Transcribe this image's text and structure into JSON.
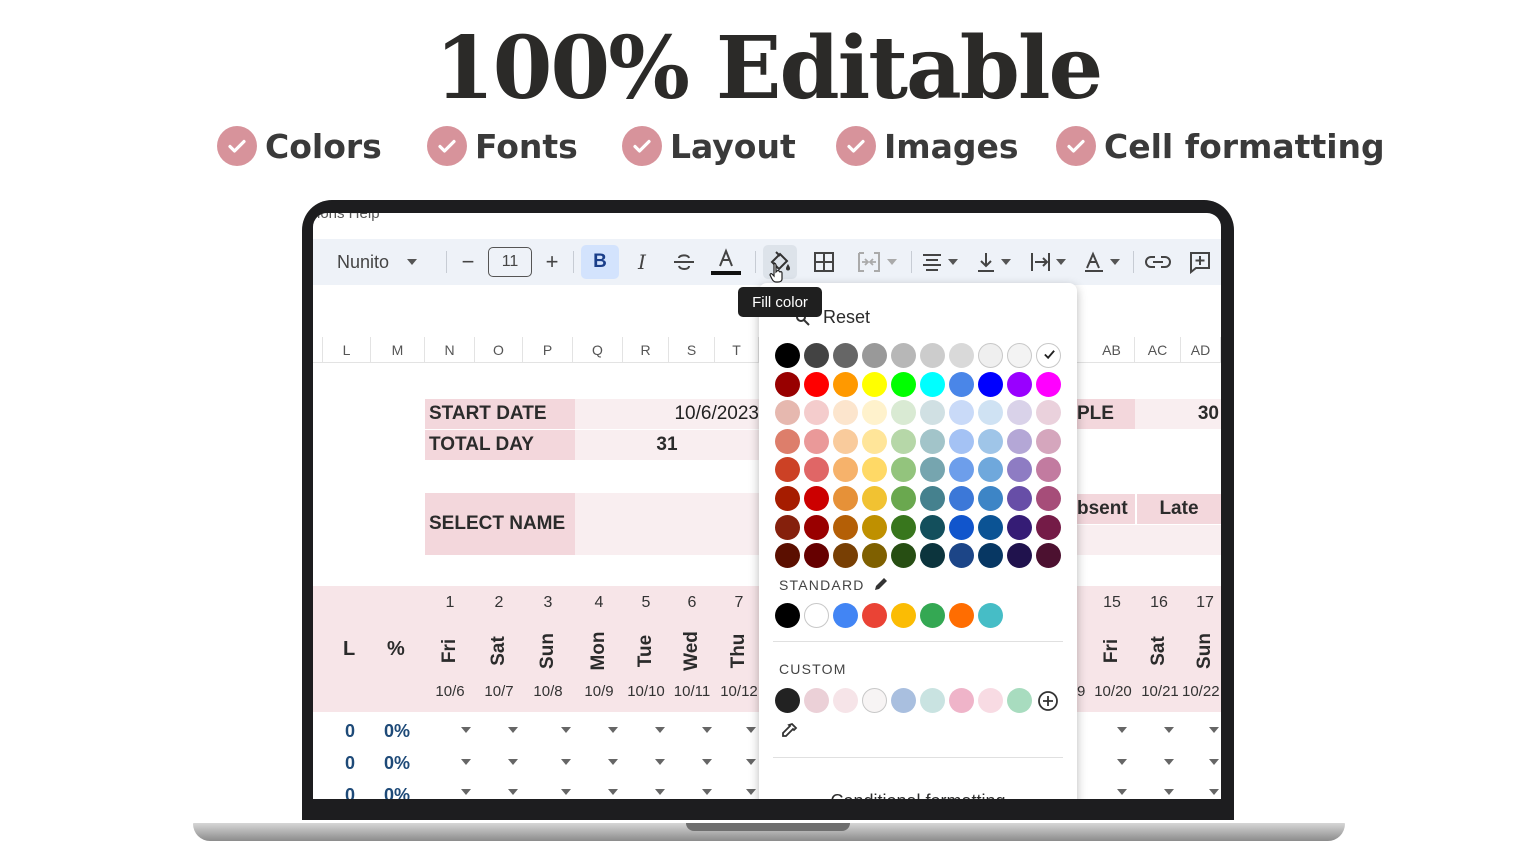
{
  "hero": {
    "title": "100% Editable",
    "features": [
      "Colors",
      "Fonts",
      "Layout",
      "Images",
      "Cell formatting"
    ]
  },
  "menu_peek": "ions   Help",
  "toolbar": {
    "font": "Nunito",
    "font_size": "11",
    "minus": "−",
    "plus": "+",
    "bold": "B",
    "italic": "I",
    "tooltip": "Fill color",
    "icons": [
      "font-dropdown-icon",
      "minus-icon",
      "plus-icon",
      "bold-icon",
      "italic-icon",
      "strikethrough-icon",
      "text-color-icon",
      "fill-color-icon",
      "borders-icon",
      "merge-cells-icon",
      "align-icon",
      "valign-icon",
      "text-wrap-icon",
      "text-rotation-icon",
      "link-icon",
      "comment-icon"
    ]
  },
  "columns": {
    "left": [
      "L",
      "M",
      "N",
      "O",
      "P",
      "Q",
      "R",
      "S",
      "T"
    ],
    "right": [
      "AB",
      "AC",
      "AD"
    ]
  },
  "sheet": {
    "start_date_label": "START DATE",
    "start_date_value": "10/6/2023",
    "total_day_label": "TOTAL DAY",
    "total_day_value": "31",
    "select_name_label": "SELECT NAME",
    "people_label": "PLE",
    "people_value": "30",
    "absent_label": "bsent",
    "late_label": "Late",
    "col_l": "L",
    "col_pct": "%",
    "days_left": [
      {
        "num": "1",
        "day": "Fri",
        "date": "10/6"
      },
      {
        "num": "2",
        "day": "Sat",
        "date": "10/7"
      },
      {
        "num": "3",
        "day": "Sun",
        "date": "10/8"
      },
      {
        "num": "4",
        "day": "Mon",
        "date": "10/9"
      },
      {
        "num": "5",
        "day": "Tue",
        "date": "10/10"
      },
      {
        "num": "6",
        "day": "Wed",
        "date": "10/11"
      },
      {
        "num": "7",
        "day": "Thu",
        "date": "10/12"
      }
    ],
    "days_right": [
      {
        "num": "15",
        "day": "Fri",
        "date": "10/20"
      },
      {
        "num": "16",
        "day": "Sat",
        "date": "10/21"
      },
      {
        "num": "17",
        "day": "Sun",
        "date": "10/22"
      }
    ],
    "date_peek": "9",
    "rows": [
      {
        "l": "0",
        "pct": "0%"
      },
      {
        "l": "0",
        "pct": "0%"
      },
      {
        "l": "0",
        "pct": "0%"
      }
    ]
  },
  "fill_menu": {
    "reset": "Reset",
    "standard_label": "STANDARD",
    "custom_label": "CUSTOM",
    "conditional": "Conditional formatting",
    "palette": [
      [
        "#000000",
        "#434343",
        "#666666",
        "#999999",
        "#b7b7b7",
        "#cccccc",
        "#d9d9d9",
        "#efefef",
        "#f3f3f3",
        "#ffffff"
      ],
      [
        "#980000",
        "#ff0000",
        "#ff9900",
        "#ffff00",
        "#00ff00",
        "#00ffff",
        "#4a86e8",
        "#0000ff",
        "#9900ff",
        "#ff00ff"
      ],
      [
        "#e6b8af",
        "#f4cccc",
        "#fce5cd",
        "#fff2cc",
        "#d9ead3",
        "#d0e0e3",
        "#c9daf8",
        "#cfe2f3",
        "#d9d2e9",
        "#ead1dc"
      ],
      [
        "#dd7e6b",
        "#ea9999",
        "#f9cb9c",
        "#ffe599",
        "#b6d7a8",
        "#a2c4c9",
        "#a4c2f4",
        "#9fc5e8",
        "#b4a7d6",
        "#d5a6bd"
      ],
      [
        "#cc4125",
        "#e06666",
        "#f6b26b",
        "#ffd966",
        "#93c47d",
        "#76a5af",
        "#6d9eeb",
        "#6fa8dc",
        "#8e7cc3",
        "#c27ba0"
      ],
      [
        "#a61c00",
        "#cc0000",
        "#e69138",
        "#f1c232",
        "#6aa84f",
        "#45818e",
        "#3c78d8",
        "#3d85c6",
        "#674ea7",
        "#a64d79"
      ],
      [
        "#85200c",
        "#990000",
        "#b45f06",
        "#bf9000",
        "#38761d",
        "#134f5c",
        "#1155cc",
        "#0b5394",
        "#351c75",
        "#741b47"
      ],
      [
        "#5b0f00",
        "#660000",
        "#783f04",
        "#7f6000",
        "#274e13",
        "#0c343d",
        "#1c4587",
        "#073763",
        "#20124d",
        "#4c1130"
      ]
    ],
    "standard": [
      "#000000",
      "#ffffff",
      "#4285f4",
      "#ea4335",
      "#fbbc04",
      "#34a853",
      "#ff6d01",
      "#46bdc6"
    ],
    "custom": [
      "#222222",
      "#ebd0d7",
      "#f6e4e8",
      "#f7f4f4",
      "#a9bfdf",
      "#c9e3e1",
      "#efb4c9",
      "#f8dbe3",
      "#a8dcbf"
    ],
    "selected_index": [
      0,
      9
    ]
  }
}
